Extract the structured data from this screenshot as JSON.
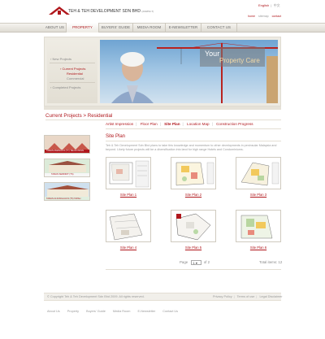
{
  "header": {
    "company_name": "TEH & TEH DEVELOPMENT SDN BHD",
    "company_reg": "(204853-T)",
    "language": {
      "current": "English",
      "other": "中文"
    },
    "top_links": [
      "home",
      "sitemap",
      "contact"
    ]
  },
  "nav": [
    "About Us",
    "Property",
    "Buyers' Guide",
    "Media Room",
    "E-Newsletter",
    "Contact Us"
  ],
  "side_menu": {
    "new_projects": "New Projects",
    "current_projects": "Current Projects",
    "residential": "Residential",
    "commercial": "Commercial",
    "completed_projects": "Completed Projects"
  },
  "banner": {
    "line1": "Your",
    "line2": "Property Care"
  },
  "breadcrumb": "Current Projects > Residential",
  "tabs": [
    "Artist Impression",
    "Floor Plan",
    "Site Plan",
    "Location Map",
    "Construction Progress"
  ],
  "active_tab": "Site Plan",
  "section_title": "Site Plan",
  "description": "Teh & Teh Development Sdn Bhd plans to take this knowledge and momentum to other developments in peninsular Malaysia and beyond. Likely future projects will be a diversification into land for high range Hotels and Condominiums.",
  "projects": [
    {
      "name": "TAMAN AMANJAYA (TY) TELUK INTAN"
    },
    {
      "name": "TAMAN SERINDIT (TS)"
    },
    {
      "name": "TAMAN ALSONGAJAYA (T5) TAPAH"
    }
  ],
  "site_plans": [
    {
      "label": "Site Plan 1"
    },
    {
      "label": "Site Plan 2"
    },
    {
      "label": "Site Plan 3"
    },
    {
      "label": "Site Plan 4"
    },
    {
      "label": "Site Plan 5"
    },
    {
      "label": "Site Plan 6"
    }
  ],
  "pager": {
    "page_label": "Page",
    "current": "1",
    "of_label": "of",
    "total_pages": "2",
    "total_label": "Total items: 12"
  },
  "footer": {
    "copyright": "© Copyright Teh & Teh Development Sdn Bhd 2009. All rights reserved.",
    "legal": [
      "Privacy Policy",
      "Terms of use",
      "Legal Disclaimer"
    ],
    "bottom_nav": [
      "About Us",
      "Property",
      "Buyers' Guide",
      "Media Room",
      "E-Newsletter",
      "Contact Us"
    ]
  },
  "colors": {
    "accent": "#b0171c",
    "nav_bg": "#e6e3dc",
    "footer_bg": "#f1efea"
  }
}
